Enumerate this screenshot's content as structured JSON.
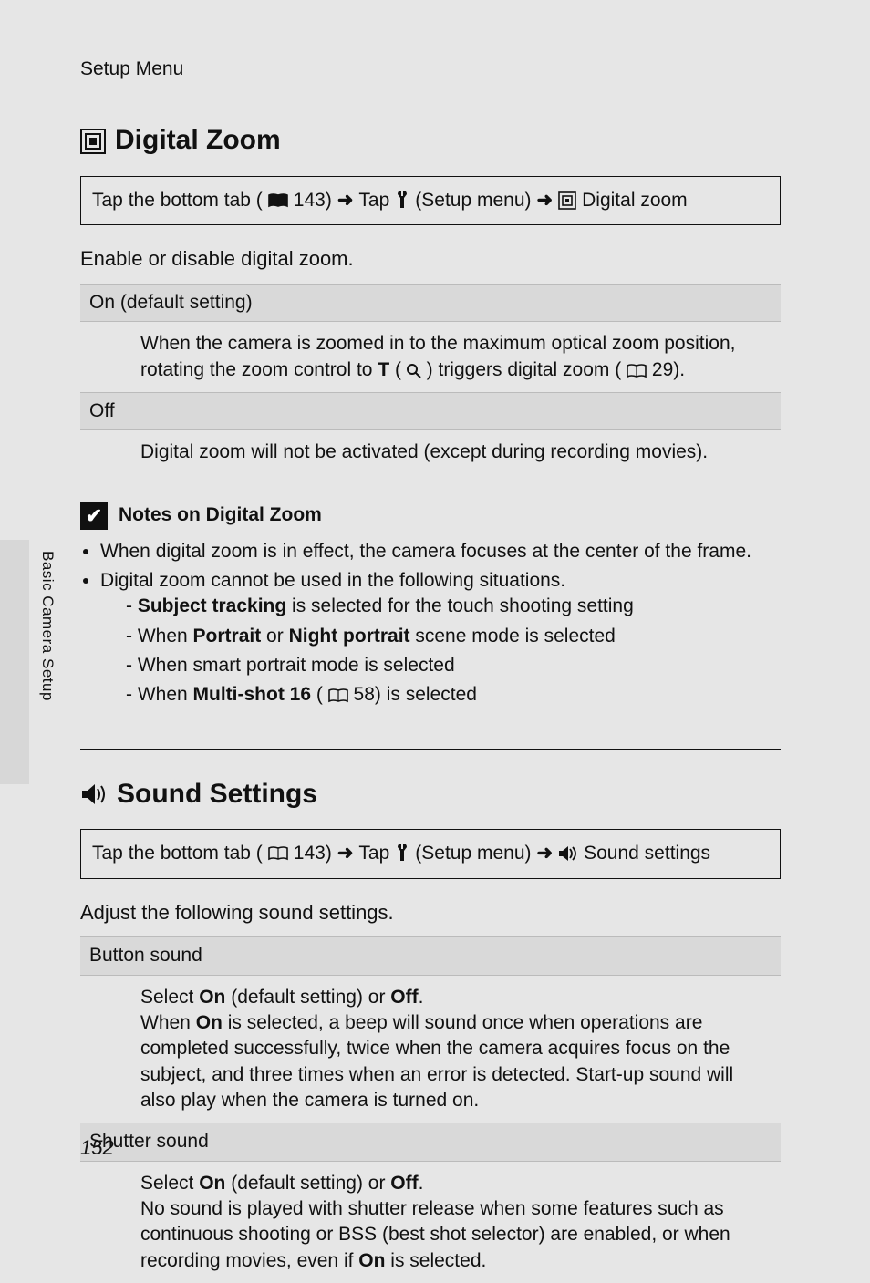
{
  "header": "Setup Menu",
  "side_label": "Basic Camera Setup",
  "page_number": "152",
  "arrow": "➜",
  "section1": {
    "title": "Digital Zoom",
    "nav": {
      "part1": "Tap the bottom tab (",
      "ref1": " 143) ",
      "part2": " Tap ",
      "setup_label": " (Setup menu) ",
      "end": " Digital zoom"
    },
    "intro": "Enable or disable digital zoom.",
    "rows": [
      {
        "label": "On (default setting)",
        "body_a": "When the camera is zoomed in to the maximum optical zoom position, rotating the zoom control to ",
        "body_t": "T",
        "body_b": " (",
        "body_c": ") triggers digital zoom (",
        "body_d": " 29)."
      },
      {
        "label": "Off",
        "body": "Digital zoom will not be activated (except during recording movies)."
      }
    ],
    "notes": {
      "title": "Notes on Digital Zoom",
      "b1": "When digital zoom is in effect, the camera focuses at the center of the frame.",
      "b2": "Digital zoom cannot be used in the following situations.",
      "d1_a": "Subject tracking",
      "d1_b": " is selected for the touch shooting setting",
      "d2_a": "When ",
      "d2_b": "Portrait",
      "d2_c": " or ",
      "d2_d": "Night portrait",
      "d2_e": " scene mode is selected",
      "d3": "When smart portrait mode is selected",
      "d4_a": "When ",
      "d4_b": "Multi-shot 16",
      "d4_c": " (",
      "d4_d": " 58) is selected"
    }
  },
  "section2": {
    "title": "Sound Settings",
    "nav": {
      "part1": "Tap the bottom tab (",
      "ref1": " 143) ",
      "part2": " Tap ",
      "setup_label": " (Setup menu) ",
      "end": " Sound settings"
    },
    "intro": "Adjust the following sound settings.",
    "rows": [
      {
        "label": "Button sound",
        "a": "Select ",
        "b": "On",
        "c": " (default setting) or ",
        "d": "Off",
        "e": ".",
        "f": "When ",
        "g": "On",
        "h": " is selected, a beep will sound once when operations are completed successfully, twice when the camera acquires focus on the subject, and three times when an error is detected. Start-up sound will also play when the camera is turned on."
      },
      {
        "label": "Shutter sound",
        "a": "Select ",
        "b": "On",
        "c": " (default setting) or ",
        "d": "Off",
        "e": ".",
        "f": "No sound is played with shutter release when some features such as continuous shooting or BSS (best shot selector) are enabled, or when recording movies, even if ",
        "g": "On",
        "h": " is selected."
      }
    ]
  }
}
